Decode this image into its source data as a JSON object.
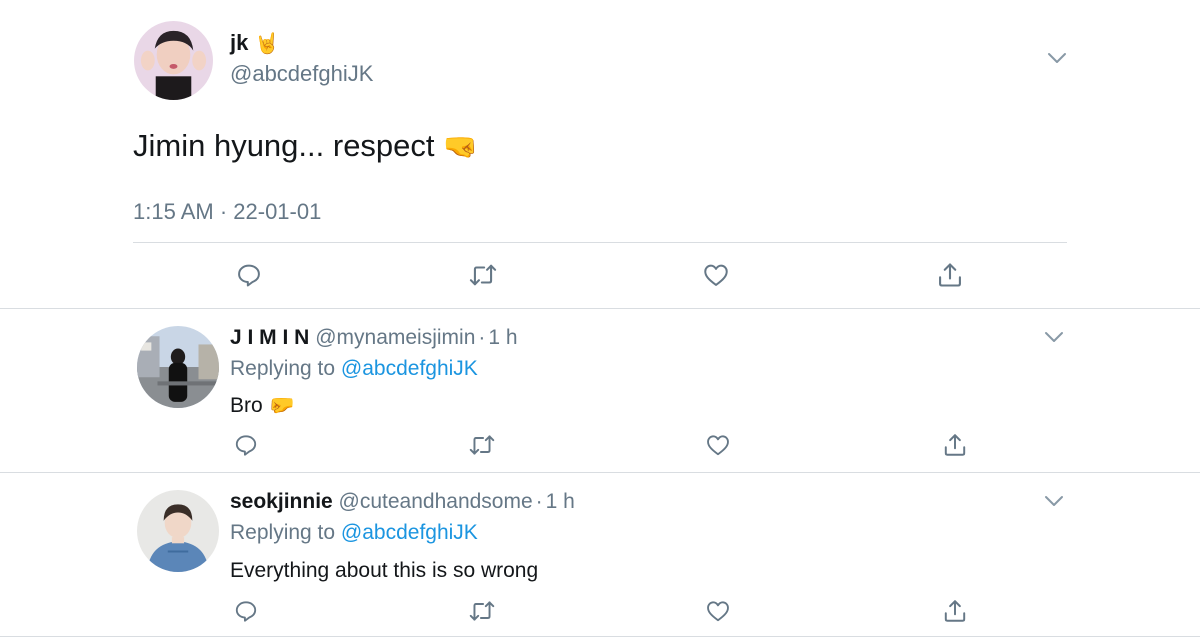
{
  "main_tweet": {
    "author_name": "jk",
    "author_emoji": "🤘",
    "handle": "@abcdefghiJK",
    "text": "Jimin hyung... respect",
    "text_emoji": "🤜",
    "timestamp": "1:15 AM · 22-01-01",
    "menu_icon": "chevron-down-icon",
    "actions": [
      "reply-icon",
      "retweet-icon",
      "like-icon",
      "share-icon"
    ]
  },
  "replies": [
    {
      "author_name": "J I M I N",
      "handle": "@mynameisjimin",
      "separator": "·",
      "time": "1 h",
      "replying_prefix": "Replying to",
      "replying_to": "@abcdefghiJK",
      "text": "Bro",
      "text_emoji": "🤛"
    },
    {
      "author_name": "seokjinnie",
      "handle": "@cuteandhandsome",
      "separator": "·",
      "time": "1 h",
      "replying_prefix": "Replying to",
      "replying_to": "@abcdefghiJK",
      "text": "Everything about this is so wrong",
      "text_emoji": ""
    }
  ],
  "colors": {
    "text": "#14171a",
    "secondary": "#657786",
    "link": "#1b95e0",
    "divider": "#d9dde1"
  }
}
